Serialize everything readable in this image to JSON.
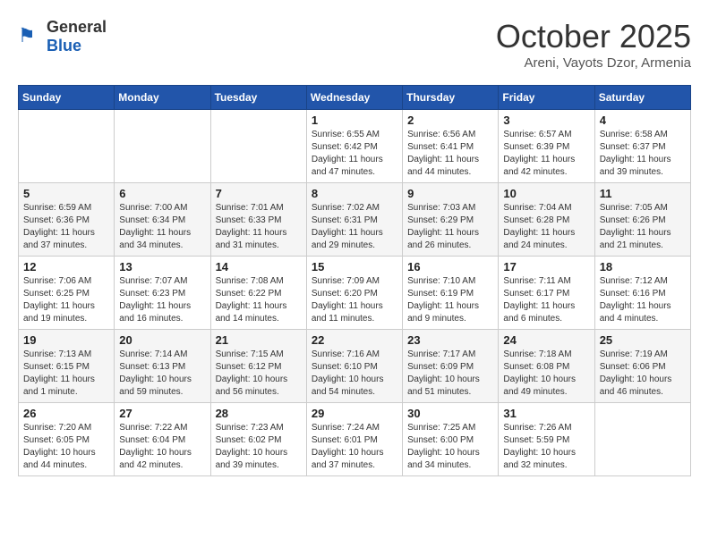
{
  "header": {
    "logo_general": "General",
    "logo_blue": "Blue",
    "month": "October 2025",
    "location": "Areni, Vayots Dzor, Armenia"
  },
  "weekdays": [
    "Sunday",
    "Monday",
    "Tuesday",
    "Wednesday",
    "Thursday",
    "Friday",
    "Saturday"
  ],
  "weeks": [
    [
      {
        "day": "",
        "info": ""
      },
      {
        "day": "",
        "info": ""
      },
      {
        "day": "",
        "info": ""
      },
      {
        "day": "1",
        "info": "Sunrise: 6:55 AM\nSunset: 6:42 PM\nDaylight: 11 hours and 47 minutes."
      },
      {
        "day": "2",
        "info": "Sunrise: 6:56 AM\nSunset: 6:41 PM\nDaylight: 11 hours and 44 minutes."
      },
      {
        "day": "3",
        "info": "Sunrise: 6:57 AM\nSunset: 6:39 PM\nDaylight: 11 hours and 42 minutes."
      },
      {
        "day": "4",
        "info": "Sunrise: 6:58 AM\nSunset: 6:37 PM\nDaylight: 11 hours and 39 minutes."
      }
    ],
    [
      {
        "day": "5",
        "info": "Sunrise: 6:59 AM\nSunset: 6:36 PM\nDaylight: 11 hours and 37 minutes."
      },
      {
        "day": "6",
        "info": "Sunrise: 7:00 AM\nSunset: 6:34 PM\nDaylight: 11 hours and 34 minutes."
      },
      {
        "day": "7",
        "info": "Sunrise: 7:01 AM\nSunset: 6:33 PM\nDaylight: 11 hours and 31 minutes."
      },
      {
        "day": "8",
        "info": "Sunrise: 7:02 AM\nSunset: 6:31 PM\nDaylight: 11 hours and 29 minutes."
      },
      {
        "day": "9",
        "info": "Sunrise: 7:03 AM\nSunset: 6:29 PM\nDaylight: 11 hours and 26 minutes."
      },
      {
        "day": "10",
        "info": "Sunrise: 7:04 AM\nSunset: 6:28 PM\nDaylight: 11 hours and 24 minutes."
      },
      {
        "day": "11",
        "info": "Sunrise: 7:05 AM\nSunset: 6:26 PM\nDaylight: 11 hours and 21 minutes."
      }
    ],
    [
      {
        "day": "12",
        "info": "Sunrise: 7:06 AM\nSunset: 6:25 PM\nDaylight: 11 hours and 19 minutes."
      },
      {
        "day": "13",
        "info": "Sunrise: 7:07 AM\nSunset: 6:23 PM\nDaylight: 11 hours and 16 minutes."
      },
      {
        "day": "14",
        "info": "Sunrise: 7:08 AM\nSunset: 6:22 PM\nDaylight: 11 hours and 14 minutes."
      },
      {
        "day": "15",
        "info": "Sunrise: 7:09 AM\nSunset: 6:20 PM\nDaylight: 11 hours and 11 minutes."
      },
      {
        "day": "16",
        "info": "Sunrise: 7:10 AM\nSunset: 6:19 PM\nDaylight: 11 hours and 9 minutes."
      },
      {
        "day": "17",
        "info": "Sunrise: 7:11 AM\nSunset: 6:17 PM\nDaylight: 11 hours and 6 minutes."
      },
      {
        "day": "18",
        "info": "Sunrise: 7:12 AM\nSunset: 6:16 PM\nDaylight: 11 hours and 4 minutes."
      }
    ],
    [
      {
        "day": "19",
        "info": "Sunrise: 7:13 AM\nSunset: 6:15 PM\nDaylight: 11 hours and 1 minute."
      },
      {
        "day": "20",
        "info": "Sunrise: 7:14 AM\nSunset: 6:13 PM\nDaylight: 10 hours and 59 minutes."
      },
      {
        "day": "21",
        "info": "Sunrise: 7:15 AM\nSunset: 6:12 PM\nDaylight: 10 hours and 56 minutes."
      },
      {
        "day": "22",
        "info": "Sunrise: 7:16 AM\nSunset: 6:10 PM\nDaylight: 10 hours and 54 minutes."
      },
      {
        "day": "23",
        "info": "Sunrise: 7:17 AM\nSunset: 6:09 PM\nDaylight: 10 hours and 51 minutes."
      },
      {
        "day": "24",
        "info": "Sunrise: 7:18 AM\nSunset: 6:08 PM\nDaylight: 10 hours and 49 minutes."
      },
      {
        "day": "25",
        "info": "Sunrise: 7:19 AM\nSunset: 6:06 PM\nDaylight: 10 hours and 46 minutes."
      }
    ],
    [
      {
        "day": "26",
        "info": "Sunrise: 7:20 AM\nSunset: 6:05 PM\nDaylight: 10 hours and 44 minutes."
      },
      {
        "day": "27",
        "info": "Sunrise: 7:22 AM\nSunset: 6:04 PM\nDaylight: 10 hours and 42 minutes."
      },
      {
        "day": "28",
        "info": "Sunrise: 7:23 AM\nSunset: 6:02 PM\nDaylight: 10 hours and 39 minutes."
      },
      {
        "day": "29",
        "info": "Sunrise: 7:24 AM\nSunset: 6:01 PM\nDaylight: 10 hours and 37 minutes."
      },
      {
        "day": "30",
        "info": "Sunrise: 7:25 AM\nSunset: 6:00 PM\nDaylight: 10 hours and 34 minutes."
      },
      {
        "day": "31",
        "info": "Sunrise: 7:26 AM\nSunset: 5:59 PM\nDaylight: 10 hours and 32 minutes."
      },
      {
        "day": "",
        "info": ""
      }
    ]
  ]
}
